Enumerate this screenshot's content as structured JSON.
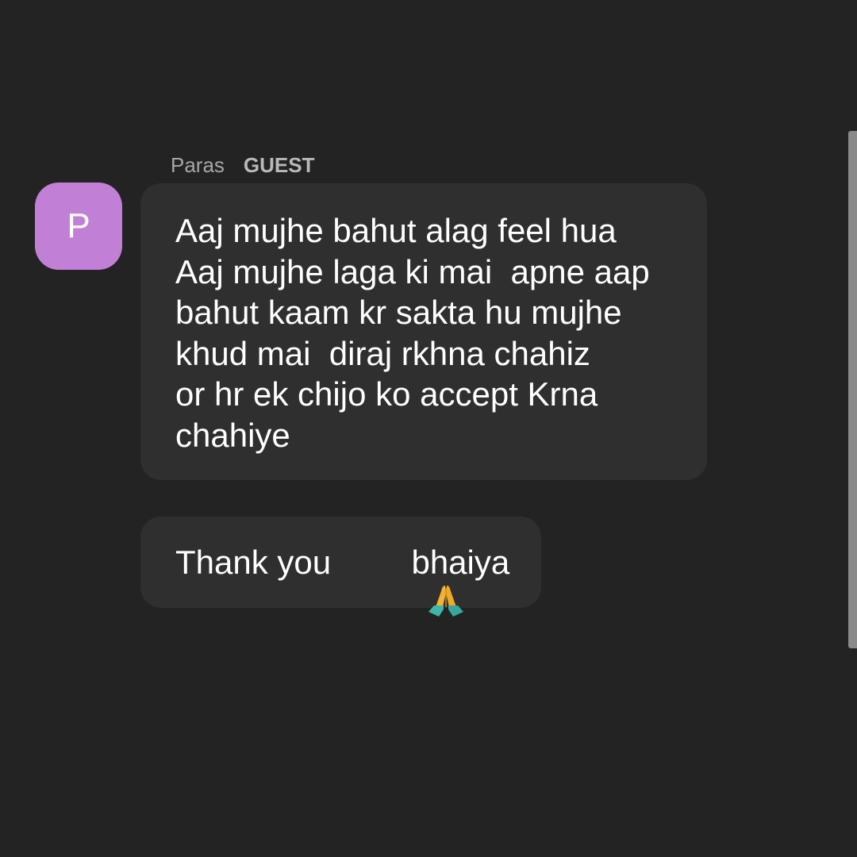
{
  "sender": {
    "name": "Paras",
    "role": "GUEST",
    "avatar_initial": "P",
    "avatar_color": "#c27fd6"
  },
  "messages": [
    {
      "lines": [
        "Aaj mujhe bahut alag feel hua",
        "Aaj mujhe laga ki mai  apne aap",
        "bahut kaam kr sakta hu mujhe",
        "khud mai  diraj rkhna chahiz",
        "or hr ek chijo ko accept Krna",
        "chahiye"
      ]
    },
    {
      "before_emoji": "Thank you ",
      "emoji": "folded-hands-icon",
      "after_emoji": " bhaiya"
    }
  ],
  "colors": {
    "background": "#232323",
    "bubble": "#2f2f2f",
    "scrollbar": "#8a8a8a"
  }
}
